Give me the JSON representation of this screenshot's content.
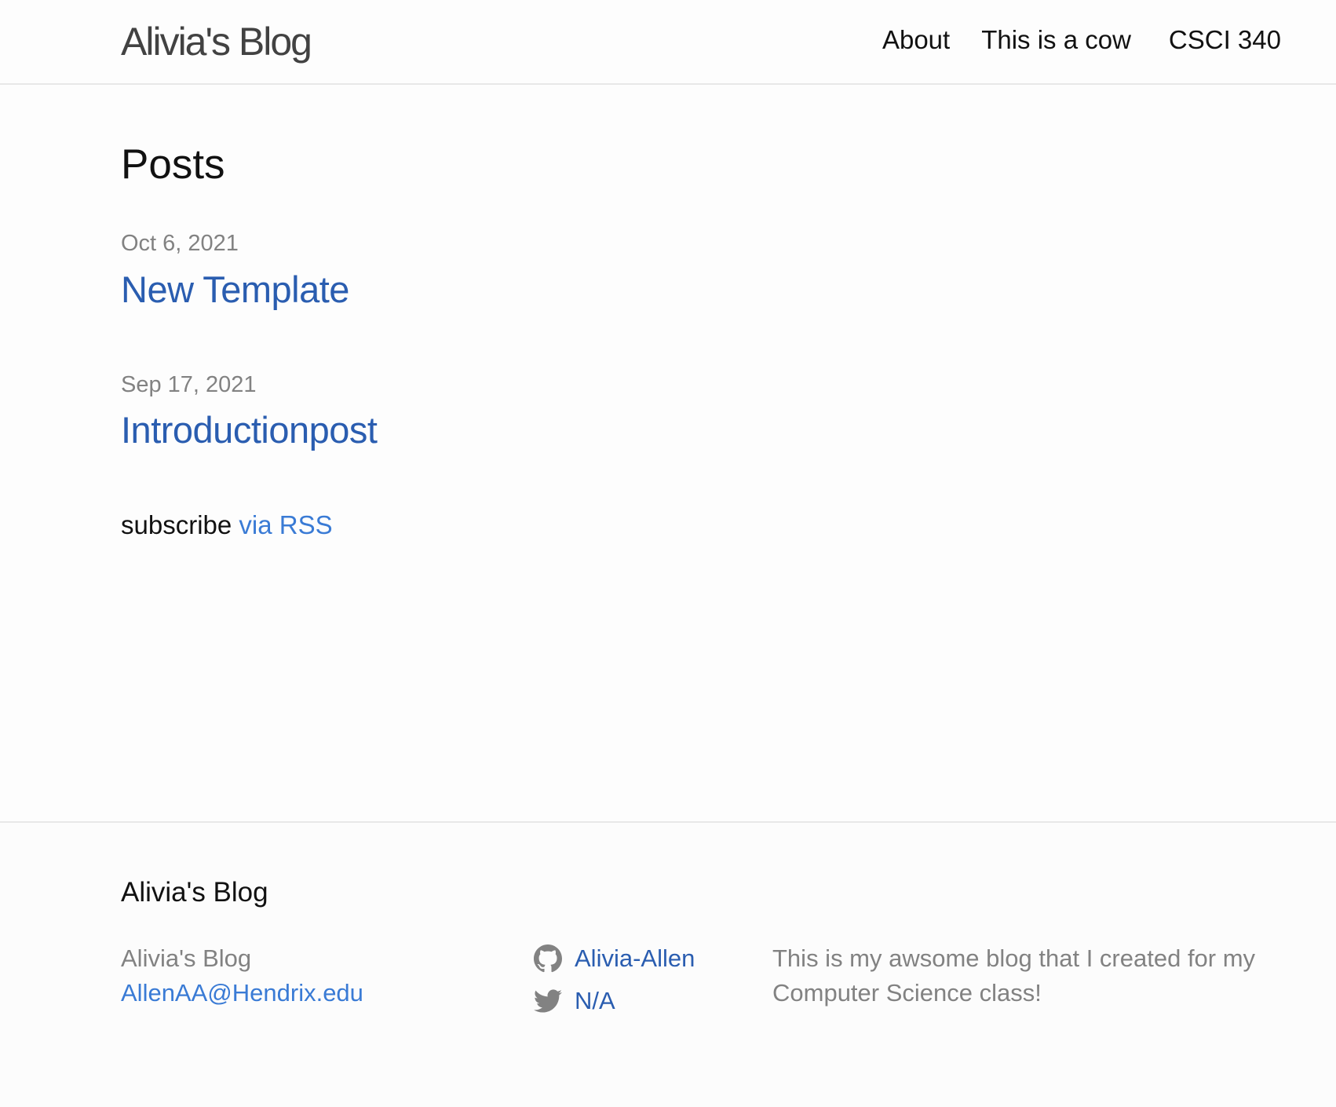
{
  "header": {
    "site_title": "Alivia's Blog",
    "nav": [
      {
        "label": "About"
      },
      {
        "label": "This is a cow"
      },
      {
        "label": "CSCI 340"
      }
    ]
  },
  "main": {
    "heading": "Posts",
    "posts": [
      {
        "date": "Oct 6, 2021",
        "title": "New Template"
      },
      {
        "date": "Sep 17, 2021",
        "title": "Introductionpost"
      }
    ],
    "rss_prefix": "subscribe",
    "rss_link": "via RSS"
  },
  "footer": {
    "heading": "Alivia's Blog",
    "name": "Alivia's Blog",
    "email": "AllenAA@Hendrix.edu",
    "social": [
      {
        "icon": "github-icon",
        "label": "Alivia-Allen"
      },
      {
        "icon": "twitter-icon",
        "label": "N/A"
      }
    ],
    "description": "This is my awsome blog that I created for my Computer Science class!"
  },
  "colors": {
    "link": "#2a5db0",
    "link_light": "#3a7bd5",
    "muted": "#828282",
    "text": "#111111"
  }
}
